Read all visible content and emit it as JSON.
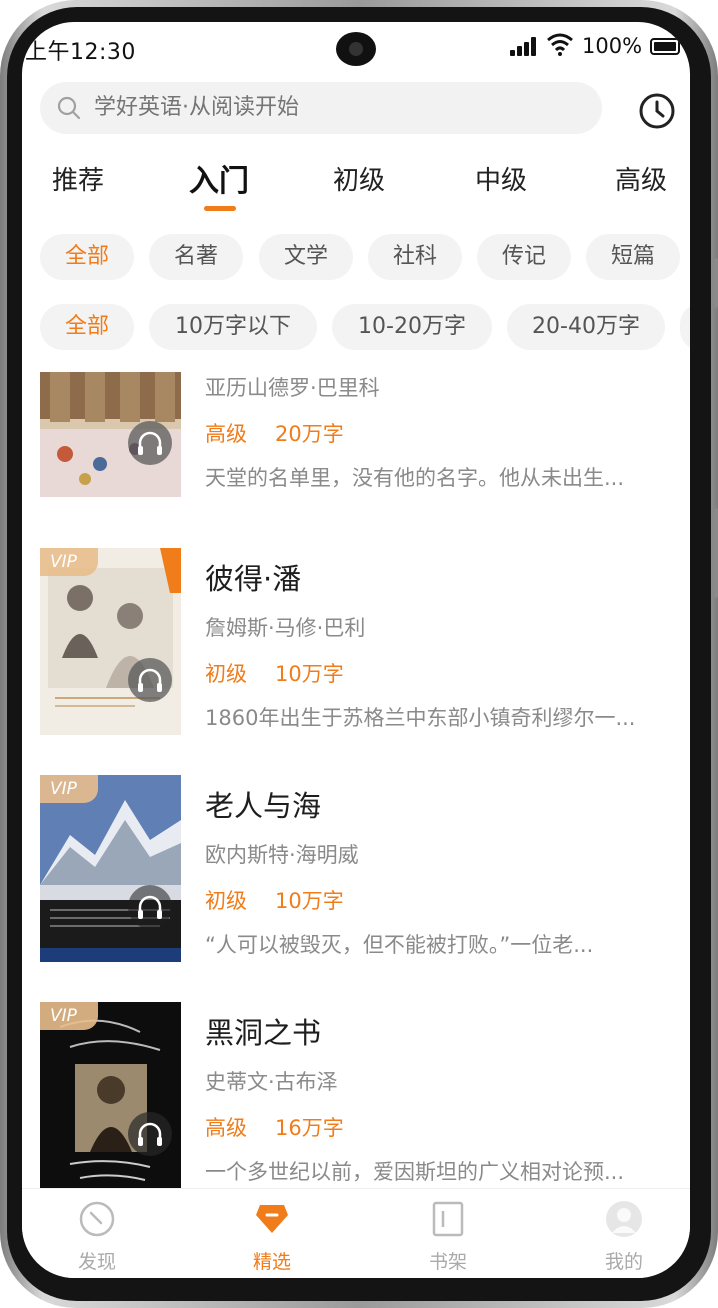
{
  "status_bar": {
    "time": "上午12:30",
    "battery": "100%"
  },
  "search": {
    "placeholder": "学好英语·从阅读开始"
  },
  "level_tabs": [
    {
      "label": "推荐",
      "active": false
    },
    {
      "label": "入门",
      "active": true
    },
    {
      "label": "初级",
      "active": false
    },
    {
      "label": "中级",
      "active": false
    },
    {
      "label": "高级",
      "active": false
    }
  ],
  "genre_filters": [
    {
      "label": "全部",
      "active": true
    },
    {
      "label": "名著",
      "active": false
    },
    {
      "label": "文学",
      "active": false
    },
    {
      "label": "社科",
      "active": false
    },
    {
      "label": "传记",
      "active": false
    },
    {
      "label": "短篇",
      "active": false
    }
  ],
  "length_filters": [
    {
      "label": "全部",
      "active": true
    },
    {
      "label": "10万字以下",
      "active": false
    },
    {
      "label": "10-20万字",
      "active": false
    },
    {
      "label": "20-40万字",
      "active": false
    }
  ],
  "books": [
    {
      "title": "",
      "author": "亚历山德罗·巴里科",
      "level": "高级",
      "words": "20万字",
      "description": "天堂的名单里，没有他的名字。他从未出生...",
      "vip": false,
      "audio": true
    },
    {
      "title": "彼得·潘",
      "author": "詹姆斯·马修·巴利",
      "level": "初级",
      "words": "10万字",
      "description": "1860年出生于苏格兰中东部小镇奇利缪尔一...",
      "vip": true,
      "audio": true
    },
    {
      "title": "老人与海",
      "author": "欧内斯特·海明威",
      "level": "初级",
      "words": "10万字",
      "description": "“人可以被毁灭，但不能被打败。”一位老...",
      "vip": true,
      "audio": true
    },
    {
      "title": "黑洞之书",
      "author": "史蒂文·古布泽",
      "level": "高级",
      "words": "16万字",
      "description": "一个多世纪以前，爱因斯坦的广义相对论预...",
      "vip": true,
      "audio": true
    }
  ],
  "vip_label": "VIP",
  "bottom_nav": [
    {
      "label": "发现",
      "icon": "compass-icon",
      "active": false
    },
    {
      "label": "精选",
      "icon": "diamond-icon",
      "active": true
    },
    {
      "label": "书架",
      "icon": "bookshelf-icon",
      "active": false
    },
    {
      "label": "我的",
      "icon": "avatar-icon",
      "active": false
    }
  ],
  "colors": {
    "accent": "#f07c1a",
    "chip_bg": "#f3f3f3",
    "muted_text": "#8a8a8a"
  }
}
